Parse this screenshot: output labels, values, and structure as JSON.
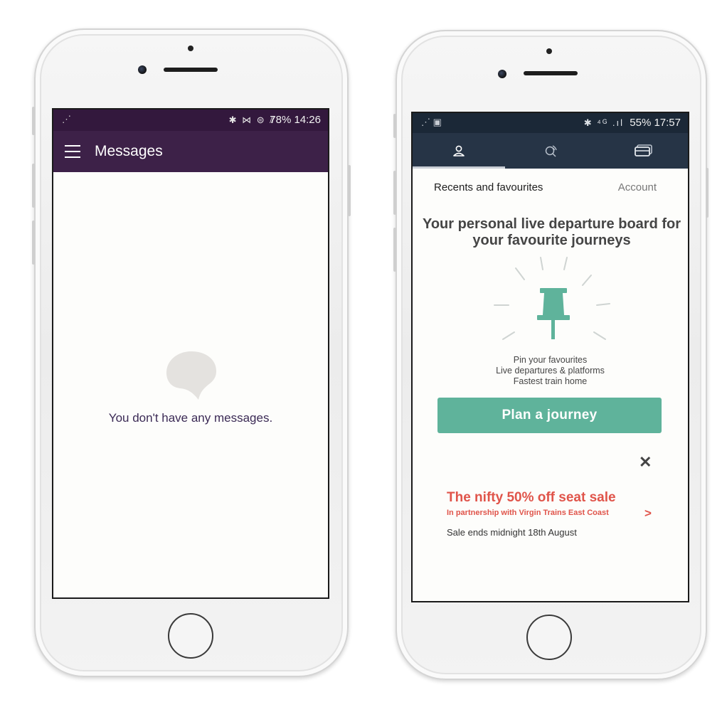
{
  "left_phone": {
    "status_bar": {
      "left_icon": "signal-icon",
      "icons": "✱ ⋈ ⊜ ⫽",
      "battery_time": "78%  14:26"
    },
    "app_bar": {
      "title": "Messages",
      "menu_icon": "hamburger-icon"
    },
    "empty_state": {
      "icon": "chat-bubble-icon",
      "message": "You don't have any messages."
    },
    "colors": {
      "status": "#33183d",
      "app_bar": "#3d2148",
      "text": "#3b2a55"
    }
  },
  "right_phone": {
    "status_bar": {
      "icons": "✱ ⁴ᴳ .ıl",
      "battery_time": "55%  17:57"
    },
    "tabs": [
      {
        "icon": "person-icon",
        "active": true
      },
      {
        "icon": "search-radar-icon",
        "active": false
      },
      {
        "icon": "tickets-icon",
        "active": false
      }
    ],
    "subtabs": {
      "left": "Recents and favourites",
      "right": "Account"
    },
    "headline": "Your personal live departure board for your favourite journeys",
    "features": [
      "Pin your favourites",
      "Live departures & platforms",
      "Fastest train home"
    ],
    "plan_button": "Plan a journey",
    "promo": {
      "close": "✕",
      "title": "The nifty 50% off seat sale",
      "subtitle": "In partnership with Virgin Trains East Coast",
      "chevron": ">",
      "note": "Sale ends midnight 18th August"
    },
    "colors": {
      "status": "#1b2837",
      "app_bar": "#263446",
      "accent": "#5fb39b",
      "promo": "#e0544a"
    }
  }
}
